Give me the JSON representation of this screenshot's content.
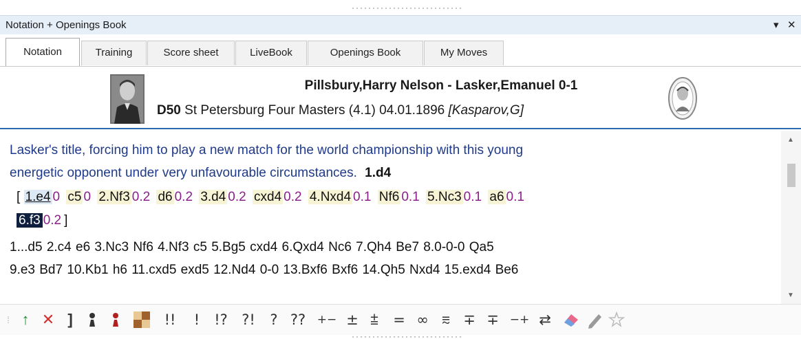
{
  "panel": {
    "title": "Notation + Openings Book",
    "dropdown_icon": "▾",
    "close_icon": "✕"
  },
  "tabs": [
    "Notation",
    "Training",
    "Score sheet",
    "LiveBook",
    "Openings Book",
    "My Moves"
  ],
  "game": {
    "players": "Pillsbury,Harry Nelson - Lasker,Emanuel  0-1",
    "eco": "D50",
    "event": "St Petersburg Four Masters (4.1) 04.01.1896",
    "annotator": "[Kasparov,G]"
  },
  "notation": {
    "comment_line1": "Lasker's title, forcing him to play a new match for the world championship with this young",
    "comment_line2": "energetic opponent under very unfavourable circumstances.",
    "move_after_comment": "1.d4",
    "var_open": "[",
    "var_close": "]",
    "variation": [
      {
        "move": "1.e4",
        "eval": "0"
      },
      {
        "move": "c5",
        "eval": "0"
      },
      {
        "move": "2.Nf3",
        "eval": "0.2"
      },
      {
        "move": "d6",
        "eval": "0.2"
      },
      {
        "move": "3.d4",
        "eval": "0.2"
      },
      {
        "move": "cxd4",
        "eval": "0.2"
      },
      {
        "move": "4.Nxd4",
        "eval": "0.1"
      },
      {
        "move": "Nf6",
        "eval": "0.1"
      },
      {
        "move": "5.Nc3",
        "eval": "0.1"
      },
      {
        "move": "a6",
        "eval": "0.1"
      }
    ],
    "current_move": "6.f3",
    "current_eval": "0.2",
    "main_line1": "1...d5  2.c4  e6  3.Nc3  Nf6  4.Nf3  c5  5.Bg5  cxd4  6.Qxd4  Nc6  7.Qh4  Be7  8.0-0-0  Qa5",
    "main_line2": "9.e3  Bd7  10.Kb1  h6  11.cxd5  exd5  12.Nd4  0-0  13.Bxf6  Bxf6  14.Qh5  Nxd4  15.exd4  Be6"
  },
  "toolbar": {
    "arrow_up_icon": "↑",
    "delete_icon": "✕",
    "bracket": "]",
    "symbols": [
      "!!",
      "!",
      "!?",
      "?!",
      "?",
      "??",
      "+−",
      "±",
      "⩲",
      "=",
      "∞",
      "⩳",
      "∓",
      "∓",
      "−+",
      "⇄"
    ]
  }
}
